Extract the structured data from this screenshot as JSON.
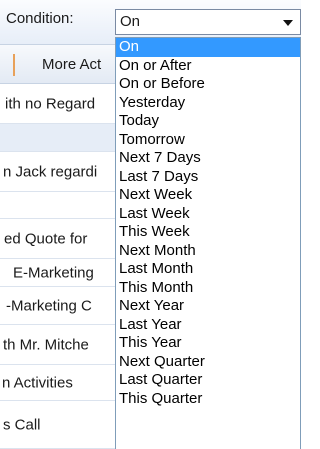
{
  "filter": {
    "condition_label": "Condition:",
    "selected_value": "On"
  },
  "toolbar": {
    "more_actions_label": "More Act"
  },
  "list_rows": [
    {
      "text": "ith no Regard",
      "band": false
    },
    {
      "text": "",
      "band": true
    },
    {
      "text": "n Jack regardi",
      "band": false
    },
    {
      "text": "",
      "band": false
    },
    {
      "text": "ed Quote for",
      "band": false
    },
    {
      "text": "E-Marketing",
      "band": false
    },
    {
      "text": "-Marketing C",
      "band": false
    },
    {
      "text": "th Mr. Mitche",
      "band": false
    },
    {
      "text": "n Activities",
      "band": false
    },
    {
      "text": "s Call",
      "band": false
    }
  ],
  "dropdown": {
    "options": [
      {
        "label": "On",
        "selected": true
      },
      {
        "label": "On or After"
      },
      {
        "label": "On or Before"
      },
      {
        "label": "Yesterday"
      },
      {
        "label": "Today"
      },
      {
        "label": "Tomorrow"
      },
      {
        "label": "Next 7 Days"
      },
      {
        "label": "Last 7 Days"
      },
      {
        "label": "Next Week"
      },
      {
        "label": "Last Week"
      },
      {
        "label": "This Week"
      },
      {
        "label": "Next Month"
      },
      {
        "label": "Last Month"
      },
      {
        "label": "This Month"
      },
      {
        "label": "Next Year"
      },
      {
        "label": "Last Year"
      },
      {
        "label": "This Year"
      },
      {
        "label": "Next Quarter"
      },
      {
        "label": "Last Quarter"
      },
      {
        "label": "This Quarter"
      }
    ]
  },
  "colors": {
    "selection": "#3399ff",
    "header_gradient_top": "#fbfcfe",
    "header_gradient_bottom": "#e7eef8",
    "band": "#e6edf7",
    "accent": "#e8a15a"
  }
}
